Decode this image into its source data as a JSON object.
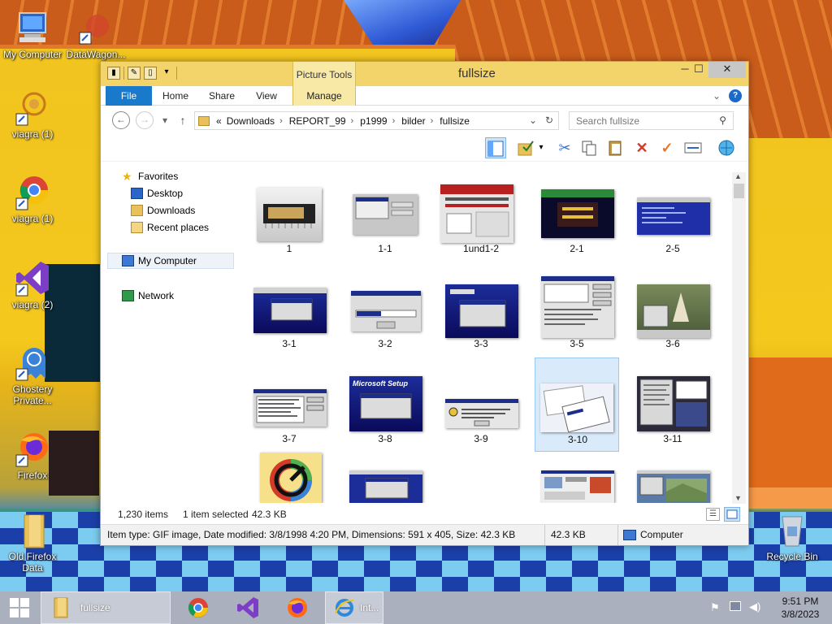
{
  "desktop": {
    "icons": [
      {
        "label": "My Computer"
      },
      {
        "label": "DataWagon..."
      },
      {
        "label": "viagra (1)"
      },
      {
        "label": "viagra (1)"
      },
      {
        "label": "viagra (2)"
      },
      {
        "label": "Ghostery Private..."
      },
      {
        "label": "Firefox"
      },
      {
        "label": "Old Firefox Data"
      },
      {
        "label": "Recycle Bin"
      }
    ]
  },
  "window": {
    "title": "fullsize",
    "context_tab": "Picture Tools",
    "ribbon_tabs": [
      "File",
      "Home",
      "Share",
      "View",
      "Manage"
    ],
    "address": {
      "prefix": "«",
      "crumbs": [
        "Downloads",
        "REPORT_99",
        "p1999",
        "bilder",
        "fullsize"
      ]
    },
    "search": {
      "placeholder": "Search fullsize"
    },
    "nav": {
      "favorites": "Favorites",
      "desktop": "Desktop",
      "downloads": "Downloads",
      "recent": "Recent places",
      "computer": "My Computer",
      "network": "Network"
    },
    "thumbnails": [
      {
        "label": "1"
      },
      {
        "label": "1-1"
      },
      {
        "label": "1und1-2"
      },
      {
        "label": "2-1"
      },
      {
        "label": "2-5"
      },
      {
        "label": "3-1"
      },
      {
        "label": "3-2"
      },
      {
        "label": "3-3"
      },
      {
        "label": "3-5"
      },
      {
        "label": "3-6"
      },
      {
        "label": "3-7"
      },
      {
        "label": "3-8"
      },
      {
        "label": "3-9"
      },
      {
        "label": "3-10"
      },
      {
        "label": "3-11"
      },
      {
        "label": ""
      },
      {
        "label": ""
      },
      {
        "label": ""
      },
      {
        "label": ""
      }
    ],
    "selected_thumbnail": "3-10",
    "status": {
      "items": "1,230 items",
      "selected": "1 item selected",
      "size": "42.3 KB"
    },
    "details": {
      "text": "Item type: GIF image, Date modified: 3/8/1998 4:20 PM, Dimensions: 591 x 405, Size: 42.3 KB",
      "size": "42.3 KB",
      "location": "Computer"
    }
  },
  "taskbar": {
    "explorer_label": "fullsize",
    "ie_label": "Int...",
    "time": "9:51 PM",
    "date": "3/8/2023"
  }
}
